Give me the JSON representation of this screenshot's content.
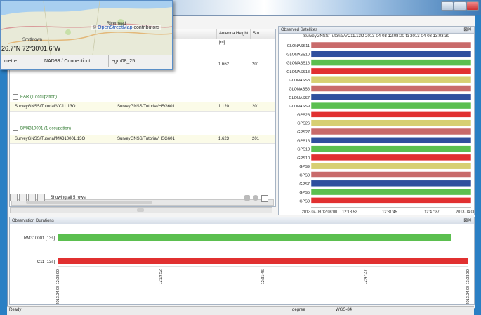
{
  "window": {
    "title": ""
  },
  "map": {
    "town": "Smithtown",
    "town2": "Riverhead",
    "attribution_link": "OpenStreetMap",
    "attribution_rest": "contributors",
    "coords": "26.7\"N 72°30'01.6\"W",
    "units": "metre",
    "datum": "NAD83 / Connecticut",
    "geoid": "egm08_25"
  },
  "table": {
    "header": {
      "antenna_height": "Antenna Height [m]",
      "more": "Sto"
    },
    "top_row": {
      "height": "1.662",
      "more": "201"
    },
    "groups": [
      {
        "label": "EAR (1 occupation)",
        "file": "SurveyGNSS/Tutorial/VC11.13O",
        "antenna": "SurveyGNSS/Tutorial/HSG601",
        "height": "1.120",
        "more": "201"
      },
      {
        "label": "BM4310001 (1 occupation)",
        "file": "SurveyGNSS/Tutorial/M4310001.13O",
        "antenna": "SurveyGNSS/Tutorial/HSG601",
        "height": "1.623",
        "more": "201"
      }
    ],
    "paging": "Showing all 5 rows"
  },
  "satellites": {
    "title": "Observed Satellites",
    "subtitle": "SurveyGNSS/Tutorial/VC11.13O 2013-04-08 12:08:00 to 2013-04-08 13:03:30",
    "rows": [
      {
        "name": "GLONASS11",
        "color": "#c96a6a"
      },
      {
        "name": "GLONASS10",
        "color": "#2f4f9e"
      },
      {
        "name": "GLONASS16",
        "color": "#5bbf4f"
      },
      {
        "name": "GLONASS18",
        "color": "#e13030"
      },
      {
        "name": "GLONASS8",
        "color": "#d7cf72"
      },
      {
        "name": "GLONASS6",
        "color": "#c96a6a"
      },
      {
        "name": "GLONASS7",
        "color": "#2f4f9e"
      },
      {
        "name": "GLONASS9",
        "color": "#5bbf4f"
      },
      {
        "name": "GPS28",
        "color": "#e13030"
      },
      {
        "name": "GPS26",
        "color": "#d7cf72"
      },
      {
        "name": "GPS27",
        "color": "#c96a6a"
      },
      {
        "name": "GPS16",
        "color": "#2f4f9e"
      },
      {
        "name": "GPS13",
        "color": "#5bbf4f"
      },
      {
        "name": "GPS10",
        "color": "#e13030"
      },
      {
        "name": "GPS9",
        "color": "#d7cf72"
      },
      {
        "name": "GPS8",
        "color": "#c96a6a"
      },
      {
        "name": "GPS7",
        "color": "#2f4f9e"
      },
      {
        "name": "GPS5",
        "color": "#5bbf4f"
      },
      {
        "name": "GPS3",
        "color": "#e13030"
      }
    ],
    "x_ticks": [
      "2013.04.08 12:08:00",
      "12:18:52",
      "12:31:45",
      "12:47:37",
      "2013.04.08"
    ]
  },
  "durations": {
    "title": "Observation Durations",
    "rows": [
      {
        "label": "RM310001 [13s]",
        "color": "#5bbf4f"
      },
      {
        "label": "C11 [13s]",
        "color": "#e13030"
      }
    ],
    "x_ticks": [
      "2013.04.08 12:08:00",
      "12:19:52",
      "12:31:45",
      "12:47:37",
      "2013.04.08 13:03:30"
    ]
  },
  "status": {
    "left": "Ready",
    "units": "degree",
    "datum": "WGS-84"
  }
}
